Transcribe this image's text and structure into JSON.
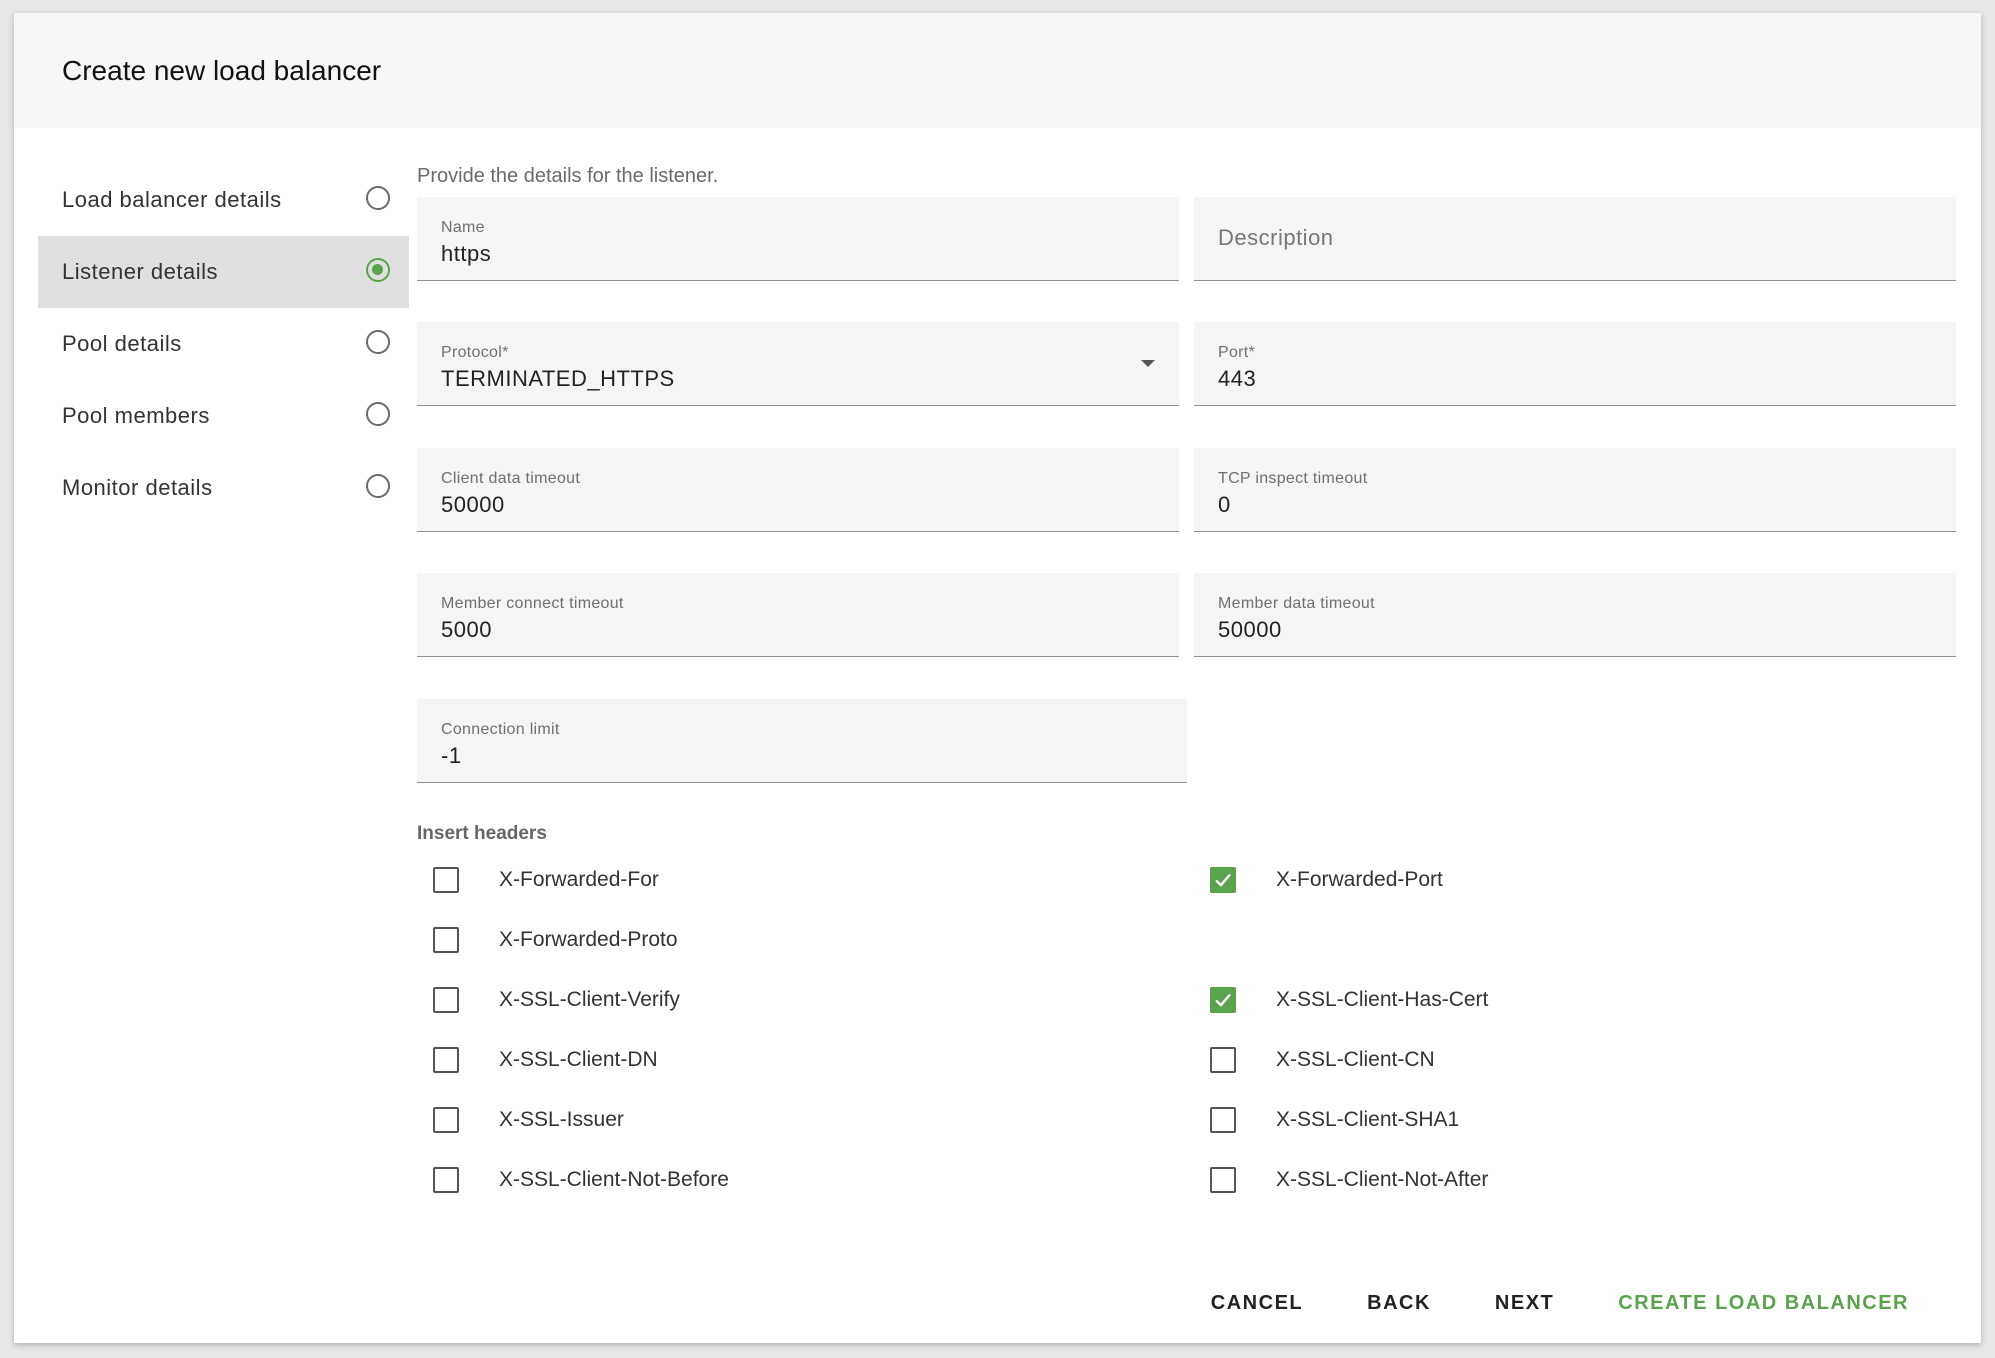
{
  "dialog": {
    "title": "Create new load balancer"
  },
  "steps": [
    {
      "label": "Load balancer details",
      "active": false
    },
    {
      "label": "Listener details",
      "active": true
    },
    {
      "label": "Pool details",
      "active": false
    },
    {
      "label": "Pool members",
      "active": false
    },
    {
      "label": "Monitor details",
      "active": false
    }
  ],
  "form": {
    "intro": "Provide the details for the listener.",
    "name": {
      "label": "Name",
      "value": "https"
    },
    "description": {
      "placeholder": "Description"
    },
    "protocol": {
      "label": "Protocol*",
      "value": "TERMINATED_HTTPS"
    },
    "port": {
      "label": "Port*",
      "value": "443"
    },
    "client_data_timeout": {
      "label": "Client data timeout",
      "value": "50000"
    },
    "tcp_inspect_timeout": {
      "label": "TCP inspect timeout",
      "value": "0"
    },
    "member_connect_timeout": {
      "label": "Member connect timeout",
      "value": "5000"
    },
    "member_data_timeout": {
      "label": "Member data timeout",
      "value": "50000"
    },
    "connection_limit": {
      "label": "Connection limit",
      "value": "-1"
    }
  },
  "insert_headers": {
    "title": "Insert headers",
    "items": [
      {
        "label": "X-Forwarded-For",
        "checked": false
      },
      {
        "label": "X-Forwarded-Port",
        "checked": true
      },
      {
        "label": "X-Forwarded-Proto",
        "checked": false
      },
      {
        "label": "X-SSL-Client-Verify",
        "checked": false
      },
      {
        "label": "X-SSL-Client-Has-Cert",
        "checked": true
      },
      {
        "label": "X-SSL-Client-DN",
        "checked": false
      },
      {
        "label": "X-SSL-Client-CN",
        "checked": false
      },
      {
        "label": "X-SSL-Issuer",
        "checked": false
      },
      {
        "label": "X-SSL-Client-SHA1",
        "checked": false
      },
      {
        "label": "X-SSL-Client-Not-Before",
        "checked": false
      },
      {
        "label": "X-SSL-Client-Not-After",
        "checked": false
      }
    ]
  },
  "actions": {
    "cancel": "CANCEL",
    "back": "BACK",
    "next": "NEXT",
    "create": "CREATE LOAD BALANCER"
  },
  "colors": {
    "accent": "#5aa34d",
    "header_bg": "#f6f6f6",
    "field_bg": "#f5f5f5"
  }
}
